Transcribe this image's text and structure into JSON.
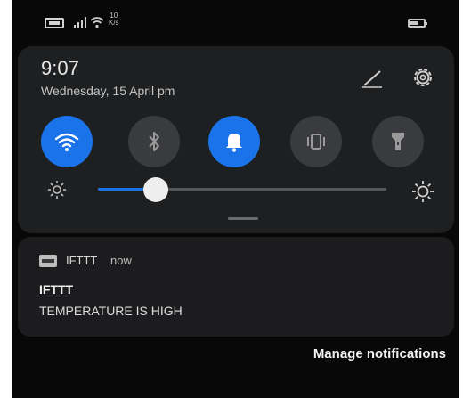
{
  "status_bar": {
    "network_speed_value": "10",
    "network_speed_unit": "K/s"
  },
  "quick_settings": {
    "time": "9:07",
    "date": "Wednesday, 15 April pm",
    "toggles": [
      {
        "name": "Wi-Fi",
        "icon": "wifi-icon",
        "on": true
      },
      {
        "name": "Bluetooth",
        "icon": "bluetooth-icon",
        "on": false
      },
      {
        "name": "Sound",
        "icon": "bell-icon",
        "on": true
      },
      {
        "name": "Vibrate",
        "icon": "vibrate-icon",
        "on": false
      },
      {
        "name": "Torch",
        "icon": "flashlight-icon",
        "on": false
      }
    ],
    "brightness": 0.2,
    "colors": {
      "accent": "#1a73e8",
      "toggle_off": "#3a3b3e",
      "panel": "#1e1f21"
    }
  },
  "notification": {
    "app_name": "IFTTT",
    "time": "now",
    "title": "IFTTT",
    "body": "TEMPERATURE IS HIGH"
  },
  "footer": {
    "manage_label": "Manage notifications"
  }
}
